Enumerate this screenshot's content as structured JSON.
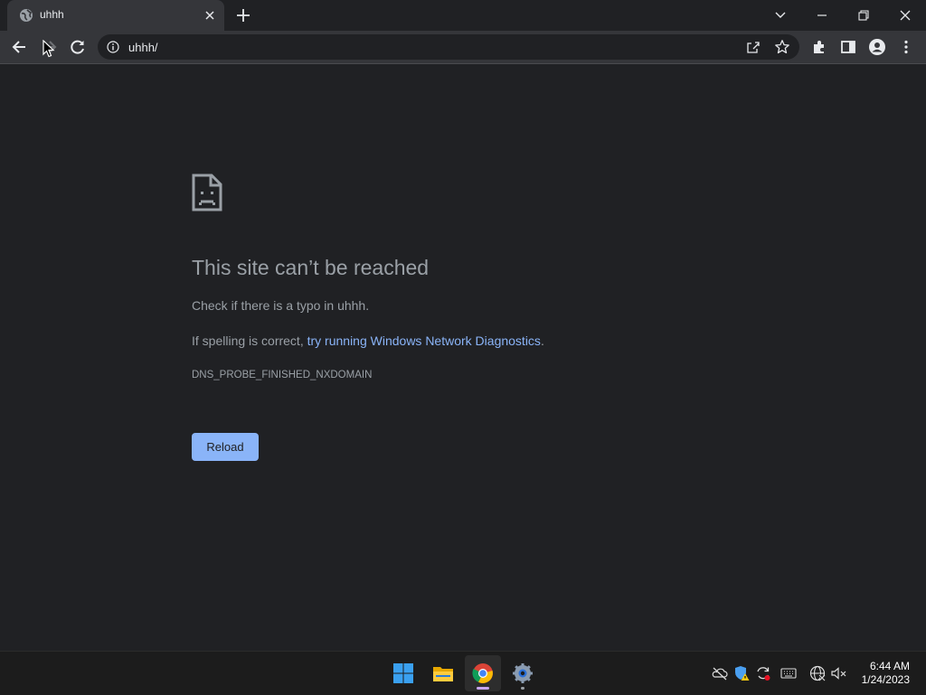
{
  "tab": {
    "title": "uhhh",
    "favicon": "globe-icon"
  },
  "address_bar": {
    "url": "uhhh/"
  },
  "error_page": {
    "title": "This site can’t be reached",
    "line1": "Check if there is a typo in uhhh.",
    "line2_prefix": "If spelling is correct, ",
    "line2_link": "try running Windows Network Diagnostics",
    "line2_suffix": ".",
    "error_code": "DNS_PROBE_FINISHED_NXDOMAIN",
    "reload_label": "Reload"
  },
  "taskbar": {
    "apps": [
      "windows-start-icon",
      "file-explorer-icon",
      "chrome-icon",
      "settings-icon"
    ],
    "tray_icons": [
      "onedrive-offline-icon",
      "security-warning-icon",
      "sync-icon",
      "keyboard-icon",
      "network-icon",
      "volume-muted-icon"
    ],
    "time": "6:44 AM",
    "date": "1/24/2023"
  },
  "colors": {
    "page_bg": "#202124",
    "toolbar_bg": "#35363a",
    "link": "#8ab4f8",
    "button": "#8ab4f8",
    "muted_text": "#9aa0a6"
  }
}
